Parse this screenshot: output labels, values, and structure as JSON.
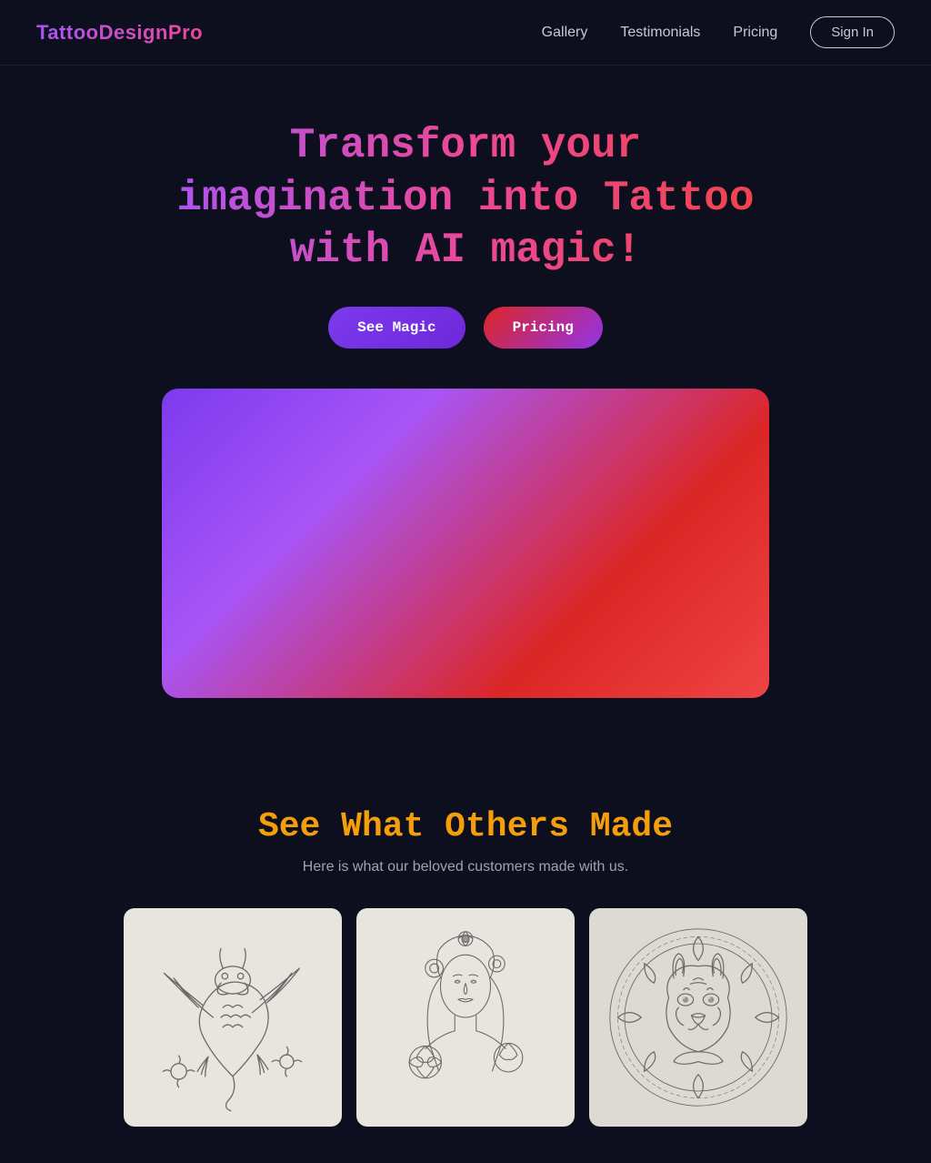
{
  "nav": {
    "logo": "TattooDesignPro",
    "links": [
      "Gallery",
      "Testimonials",
      "Pricing"
    ],
    "signin_label": "Sign In"
  },
  "hero": {
    "title": "Transform your imagination into Tattoo with AI magic!",
    "btn_magic": "See Magic",
    "btn_pricing": "Pricing"
  },
  "gallery": {
    "title": "See What Others Made",
    "subtitle": "Here is what our beloved customers made with us.",
    "cards": [
      {
        "alt": "Dragon tattoo sketch"
      },
      {
        "alt": "Woman with flowers tattoo sketch"
      },
      {
        "alt": "Wolf mandala tattoo sketch"
      }
    ]
  }
}
